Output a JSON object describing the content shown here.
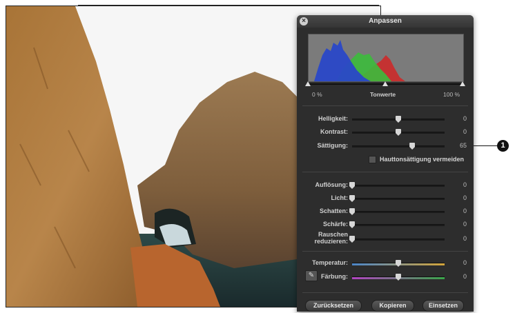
{
  "panel": {
    "title": "Anpassen",
    "close_icon": "close-icon",
    "histogram": {
      "left_label": "0 %",
      "center_label": "Tonwerte",
      "right_label": "100 %"
    },
    "sliders_top": [
      {
        "label": "Helligkeit:",
        "value": "0",
        "level": 0.5
      },
      {
        "label": "Kontrast:",
        "value": "0",
        "level": 0.5
      },
      {
        "label": "Sättigung:",
        "value": "65",
        "level": 0.65
      }
    ],
    "checkbox_label": "Hauttonsättigung vermeiden",
    "sliders_mid": [
      {
        "label": "Auflösung:",
        "value": "0",
        "level": 0
      },
      {
        "label": "Licht:",
        "value": "0",
        "level": 0
      },
      {
        "label": "Schatten:",
        "value": "0",
        "level": 0
      },
      {
        "label": "Schärfe:",
        "value": "0",
        "level": 0
      },
      {
        "label": "Rauschen reduzieren:",
        "value": "0",
        "level": 0
      }
    ],
    "sliders_color": [
      {
        "label": "Temperatur:",
        "value": "0",
        "level": 0.5
      },
      {
        "label": "Färbung:",
        "value": "0",
        "level": 0.5
      }
    ],
    "eyedropper_icon": "eyedropper-icon",
    "buttons": {
      "reset": "Zurücksetzen",
      "copy": "Kopieren",
      "paste": "Einsetzen"
    }
  },
  "callout": {
    "number": "1"
  },
  "colors": {
    "panel_bg": "#2d2d2d",
    "histogram_blue": "#2a48c8",
    "histogram_green": "#3cbb3c",
    "histogram_red": "#cc2a2a"
  }
}
